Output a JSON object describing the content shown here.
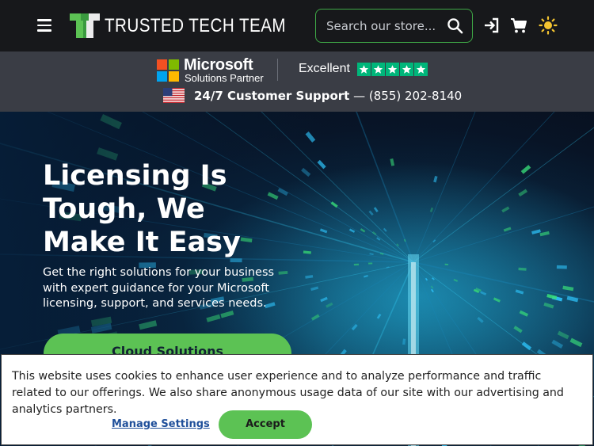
{
  "header": {
    "brand": "TRUSTED TECH TEAM",
    "search_placeholder": "Search our store...",
    "icons": [
      "menu-icon",
      "search-icon",
      "sign-in-icon",
      "cart-icon",
      "sun-icon"
    ]
  },
  "partner_strip": {
    "ms_name": "Microsoft",
    "ms_sub": "Solutions Partner",
    "rating_label": "Excellent",
    "rating_stars": 5,
    "support_bold": "24/7 Customer Support",
    "support_sep": " — ",
    "support_phone": "(855) 202-8140"
  },
  "hero": {
    "title": "Licensing Is Tough, We Make It Easy",
    "subtitle": "Get the right solutions for your business with expert guidance for your Microsoft licensing, support, and services needs.",
    "cta_label": "Cloud Solutions"
  },
  "cookie_banner": {
    "text": "This website uses cookies to enhance user experience and to analyze performance and traffic related to our offerings. We also share anonymous usage data of our site with our advertising and analytics partners.",
    "manage_label": "Manage Settings",
    "accept_label": "Accept"
  },
  "colors": {
    "brand_green": "#5cc254",
    "header_bg": "#17181b",
    "strip_bg": "#3a3d45",
    "trustpilot_green": "#00b67a"
  }
}
